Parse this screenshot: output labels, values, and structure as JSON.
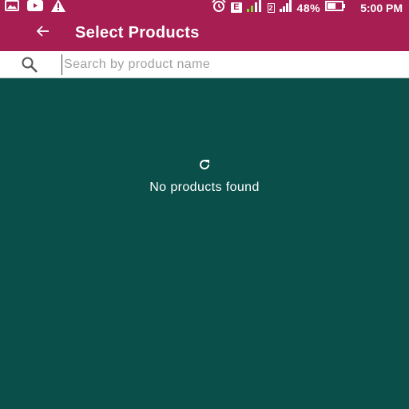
{
  "status_bar": {
    "battery_text": "48%",
    "time": "5:00 PM",
    "network_type": "E",
    "sim_slot": "2",
    "icons": [
      "image-icon",
      "youtube-icon",
      "warning-icon",
      "alarm-icon",
      "signal-icon",
      "battery-icon"
    ]
  },
  "app_bar": {
    "title": "Select Products",
    "back_icon": "arrow-back-icon"
  },
  "search": {
    "placeholder": "Search by product name",
    "value": ""
  },
  "empty_state": {
    "message": "No products found",
    "refresh_icon": "refresh-icon"
  },
  "colors": {
    "primary": "#a61e52",
    "background": "#0a4f4a",
    "search_bg": "#ffffff",
    "text_on_primary": "#ffffff"
  }
}
